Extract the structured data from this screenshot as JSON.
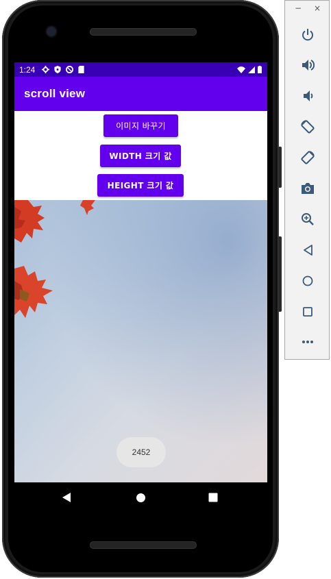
{
  "status_bar": {
    "time": "1:24"
  },
  "app_bar": {
    "title": "scroll view"
  },
  "buttons": {
    "change_image": "이미지 바꾸기",
    "width_value": "WIDTH 크기 값",
    "height_value": "HEIGHT 크기 값"
  },
  "toast": {
    "text": "2452"
  },
  "window_controls": {
    "minimize": "−",
    "close": "×"
  },
  "toolbar_icons": [
    "power-icon",
    "volume-up-icon",
    "volume-down-icon",
    "rotate-left-icon",
    "rotate-right-icon",
    "camera-icon",
    "zoom-icon",
    "back-icon",
    "home-icon",
    "overview-icon",
    "more-icon"
  ],
  "colors": {
    "status_bar": "#3700b3",
    "app_bar": "#6200ee",
    "button": "#6200ee",
    "toast_bg": "#e6e6e6"
  }
}
